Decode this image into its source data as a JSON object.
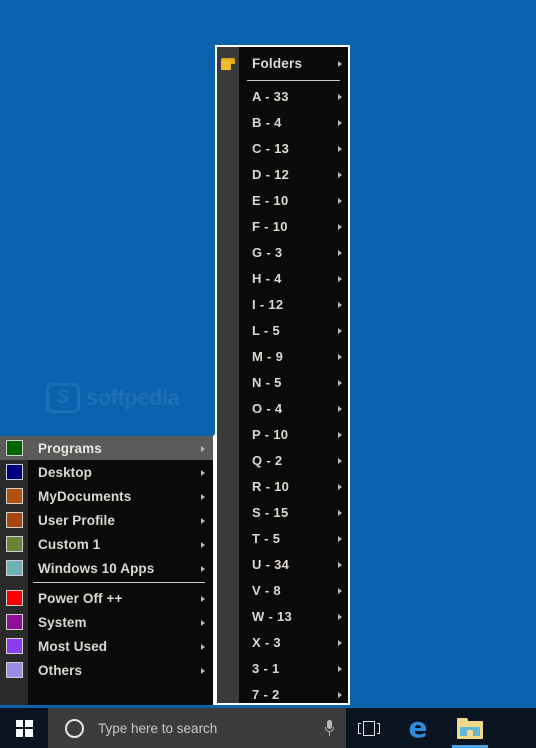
{
  "desktop": {
    "background_color": "#0c63ad",
    "watermark_text": "softpedia",
    "watermark_logo": "s-logo-icon"
  },
  "folders_menu": {
    "header": {
      "label": "Folders",
      "icon": "folder-icon",
      "arrow": "submenu-arrow-icon"
    },
    "items": [
      {
        "label": "A - 33"
      },
      {
        "label": "B - 4"
      },
      {
        "label": "C - 13"
      },
      {
        "label": "D - 12"
      },
      {
        "label": "E - 10"
      },
      {
        "label": "F - 10"
      },
      {
        "label": "G - 3"
      },
      {
        "label": "H - 4"
      },
      {
        "label": "I - 12"
      },
      {
        "label": "L - 5"
      },
      {
        "label": "M - 9"
      },
      {
        "label": "N - 5"
      },
      {
        "label": "O - 4"
      },
      {
        "label": "P - 10"
      },
      {
        "label": "Q - 2"
      },
      {
        "label": "R - 10"
      },
      {
        "label": "S - 15"
      },
      {
        "label": "T - 5"
      },
      {
        "label": "U - 34"
      },
      {
        "label": "V - 8"
      },
      {
        "label": "W - 13"
      },
      {
        "label": "X - 3"
      },
      {
        "label": "3 - 1"
      },
      {
        "label": "7 - 2"
      }
    ]
  },
  "main_menu": {
    "items": [
      {
        "label": "Programs",
        "color": "#006400",
        "selected": true,
        "separator_after": false
      },
      {
        "label": "Desktop",
        "color": "#000080",
        "selected": false,
        "separator_after": false
      },
      {
        "label": "MyDocuments",
        "color": "#b4500e",
        "selected": false,
        "separator_after": false
      },
      {
        "label": "User Profile",
        "color": "#a8470d",
        "selected": false,
        "separator_after": false
      },
      {
        "label": "Custom 1",
        "color": "#6b8339",
        "selected": false,
        "separator_after": false
      },
      {
        "label": "Windows 10 Apps",
        "color": "#6fb0b6",
        "selected": false,
        "separator_after": true
      },
      {
        "label": "Power Off ++",
        "color": "#fb0000",
        "selected": false,
        "separator_after": false
      },
      {
        "label": "System",
        "color": "#8e0e96",
        "selected": false,
        "separator_after": false
      },
      {
        "label": "Most Used",
        "color": "#8a3ef0",
        "selected": false,
        "separator_after": false
      },
      {
        "label": "Others",
        "color": "#9b8ae4",
        "selected": false,
        "separator_after": false
      }
    ]
  },
  "taskbar": {
    "start_button": "windows-start-icon",
    "search": {
      "placeholder": "Type here to search",
      "cortana_icon": "cortana-circle-icon",
      "mic_icon": "microphone-icon"
    },
    "taskview_icon": "task-view-icon",
    "edge_icon": "e",
    "explorer_icon": "file-explorer-icon"
  }
}
